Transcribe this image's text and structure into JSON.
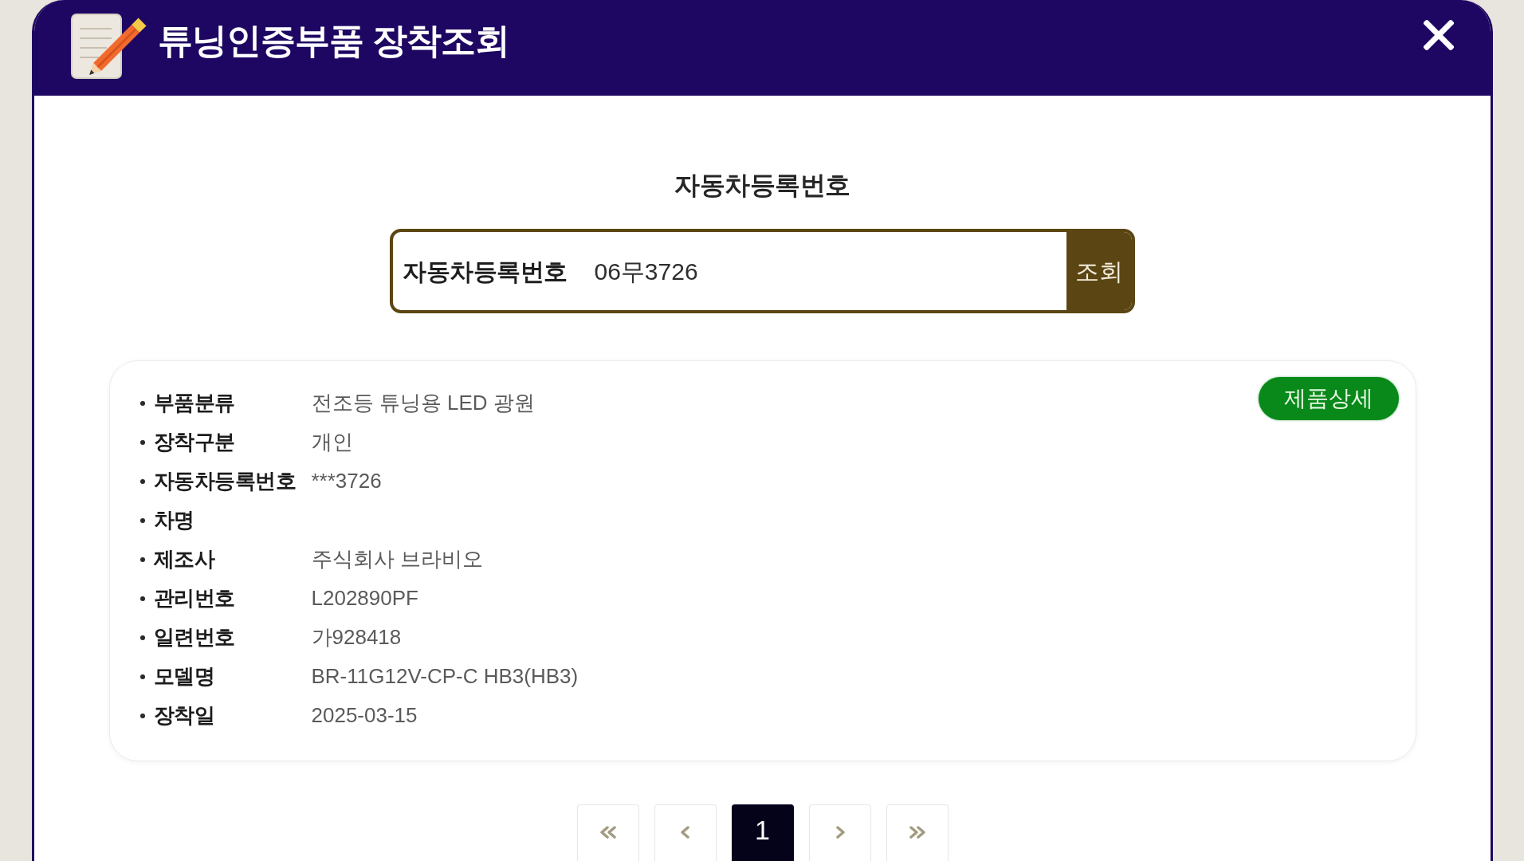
{
  "window": {
    "title": "튜닝인증부품 장착조회"
  },
  "search": {
    "heading": "자동차등록번호",
    "label": "자동차등록번호",
    "value": "06무3726",
    "button": "조회"
  },
  "result": {
    "detail_button": "제품상세",
    "fields": [
      {
        "label": "부품분류",
        "value": "전조등 튜닝용 LED 광원"
      },
      {
        "label": "장착구분",
        "value": "개인"
      },
      {
        "label": "자동차등록번호",
        "value": "***3726"
      },
      {
        "label": "차명"
      },
      {
        "label": "제조사",
        "value": "주식회사 브라비오"
      },
      {
        "label": "관리번호",
        "value": "L202890PF"
      },
      {
        "label": "일련번호",
        "value": "가928418"
      },
      {
        "label": "모델명",
        "value": "BR-11G12V-CP-C HB3(HB3)"
      },
      {
        "label": "장착일",
        "value": "2025-03-15"
      }
    ]
  },
  "pagination": {
    "pages": [
      {
        "label": "1",
        "selected": true
      }
    ]
  }
}
